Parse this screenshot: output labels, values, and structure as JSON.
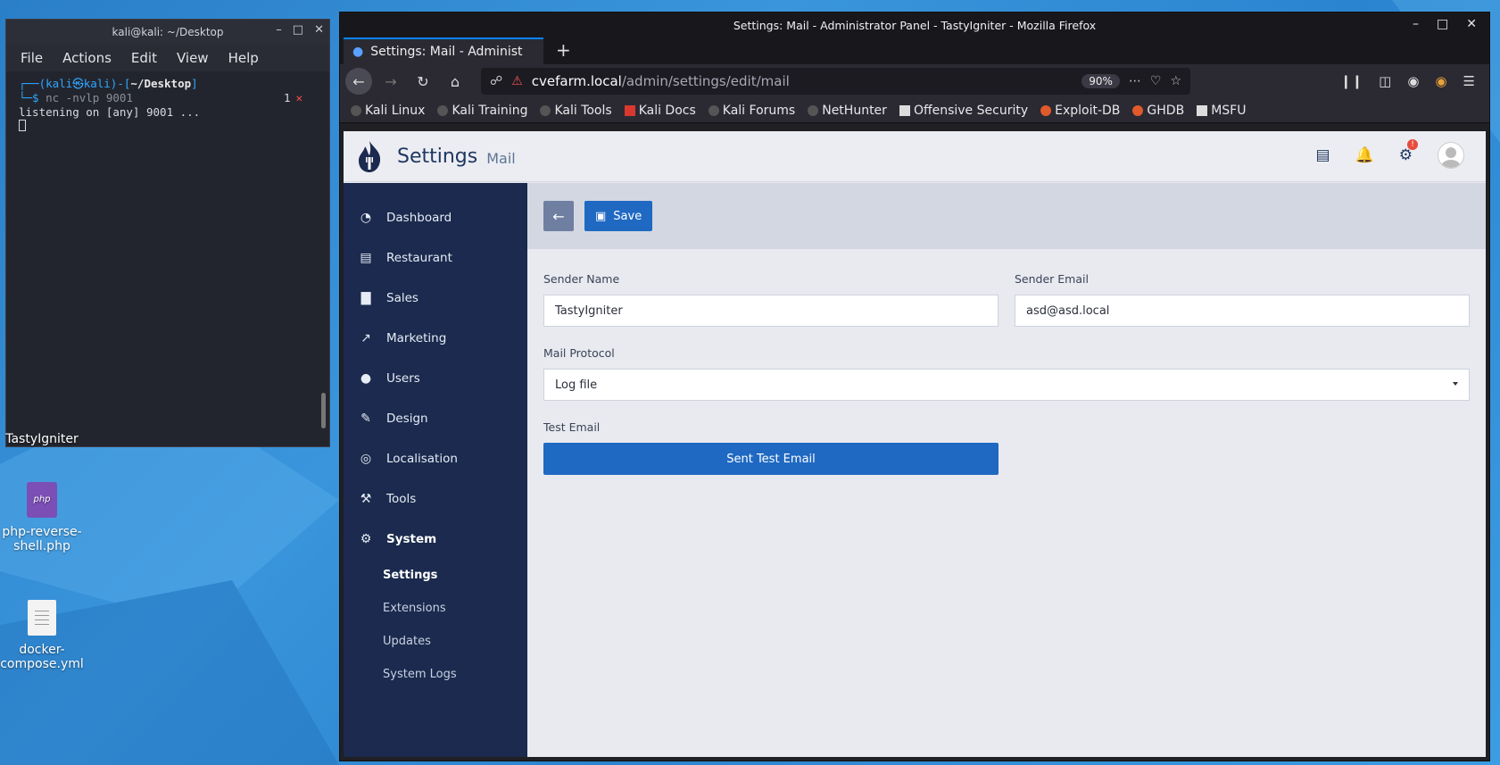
{
  "terminal": {
    "title": "kali@kali: ~/Desktop",
    "menu": [
      "File",
      "Actions",
      "Edit",
      "View",
      "Help"
    ],
    "prompt_user": "(kali㉿kali)",
    "prompt_path": "~/Desktop",
    "command": "nc -nvlp 9001",
    "status_num": "1",
    "status_mark": "✕",
    "output": "listening on [any] 9001 ..."
  },
  "desktop": {
    "icons": [
      {
        "label": "TastyIgniter"
      },
      {
        "label": "php-reverse-shell.php",
        "badge": "php"
      },
      {
        "label": "docker-compose.yml"
      }
    ]
  },
  "browser": {
    "window_title": "Settings: Mail - Administrator Panel - TastyIgniter - Mozilla Firefox",
    "tab_title": "Settings: Mail - Administ",
    "url_host": "cvefarm.local",
    "url_path": "/admin/settings/edit/mail",
    "zoom": "90%",
    "bookmarks": [
      {
        "label": "Kali Linux",
        "color": "#222222"
      },
      {
        "label": "Kali Training",
        "color": "#222222"
      },
      {
        "label": "Kali Tools",
        "color": "#222222"
      },
      {
        "label": "Kali Docs",
        "color": "#d9382e"
      },
      {
        "label": "Kali Forums",
        "color": "#222222"
      },
      {
        "label": "NetHunter",
        "color": "#222222"
      },
      {
        "label": "Offensive Security",
        "color": "#111111"
      },
      {
        "label": "Exploit-DB",
        "color": "#e05a2b"
      },
      {
        "label": "GHDB",
        "color": "#e05a2b"
      },
      {
        "label": "MSFU",
        "color": "#111111"
      }
    ]
  },
  "app": {
    "title": "Settings",
    "subtitle": "Mail",
    "sidebar": [
      {
        "label": "Dashboard",
        "icon": "◔"
      },
      {
        "label": "Restaurant",
        "icon": "▤"
      },
      {
        "label": "Sales",
        "icon": "▇"
      },
      {
        "label": "Marketing",
        "icon": "↗"
      },
      {
        "label": "Users",
        "icon": "●"
      },
      {
        "label": "Design",
        "icon": "✎"
      },
      {
        "label": "Localisation",
        "icon": "◎"
      },
      {
        "label": "Tools",
        "icon": "⚒"
      },
      {
        "label": "System",
        "icon": "⚙"
      }
    ],
    "sidebar_sub": [
      "Settings",
      "Extensions",
      "Updates",
      "System Logs"
    ],
    "toolbar": {
      "save_label": "Save"
    },
    "form": {
      "sender_name_label": "Sender Name",
      "sender_name_value": "TastyIgniter",
      "sender_email_label": "Sender Email",
      "sender_email_value": "asd@asd.local",
      "protocol_label": "Mail Protocol",
      "protocol_value": "Log file",
      "test_label": "Test Email",
      "test_button": "Sent Test Email"
    },
    "notification_badge": "!"
  }
}
